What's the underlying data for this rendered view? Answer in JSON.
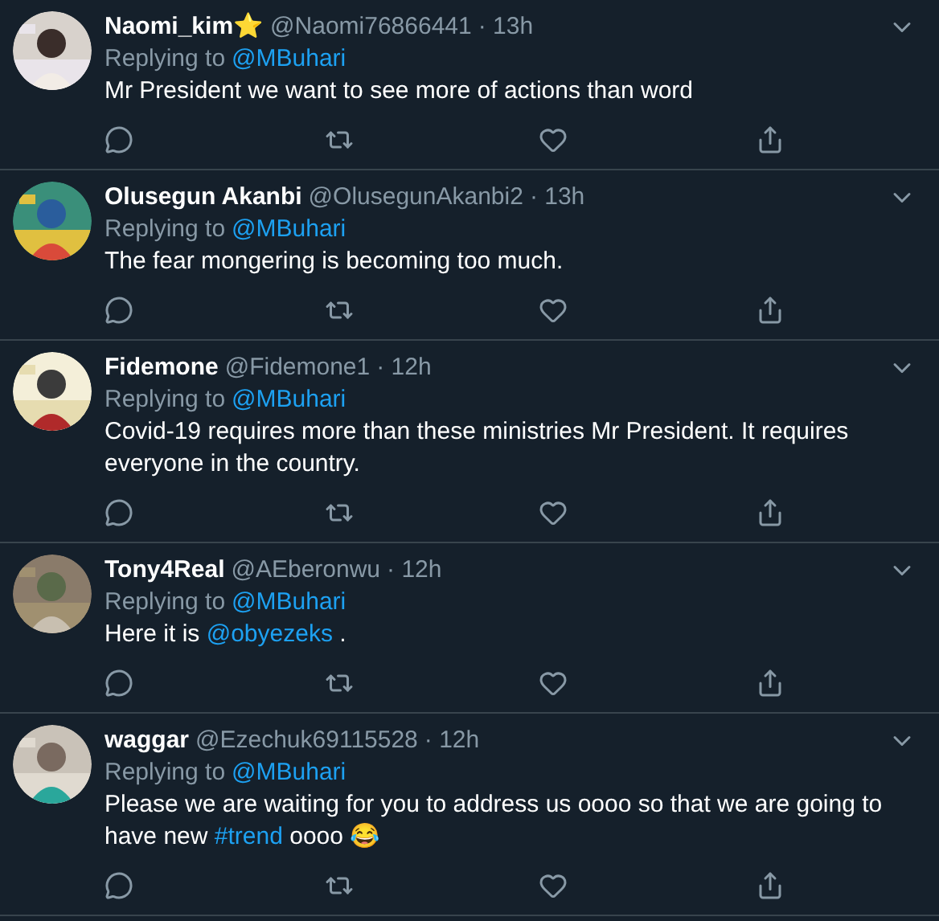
{
  "tweets": [
    {
      "name": "Naomi_kim⭐",
      "handle": "@Naomi76866441",
      "time": "· 13h",
      "replying_to": "Replying to",
      "reply_handle": "@MBuhari",
      "body": [
        {
          "kind": "text",
          "text": "Mr President we want to see more of actions than word"
        }
      ]
    },
    {
      "name": "Olusegun Akanbi",
      "handle": "@OlusegunAkanbi2",
      "time": "· 13h",
      "replying_to": "Replying to",
      "reply_handle": "@MBuhari",
      "body": [
        {
          "kind": "text",
          "text": "The fear mongering is becoming too much."
        }
      ]
    },
    {
      "name": "Fidemone",
      "handle": "@Fidemone1",
      "time": "· 12h",
      "replying_to": "Replying to",
      "reply_handle": "@MBuhari",
      "body": [
        {
          "kind": "text",
          "text": "Covid-19 requires more than these ministries Mr President. It requires everyone in the country."
        }
      ]
    },
    {
      "name": "Tony4Real",
      "handle": "@AEberonwu",
      "time": "· 12h",
      "replying_to": "Replying to",
      "reply_handle": "@MBuhari",
      "body": [
        {
          "kind": "text",
          "text": "Here it is "
        },
        {
          "kind": "link",
          "text": "@obyezeks"
        },
        {
          "kind": "text",
          "text": " ."
        }
      ]
    },
    {
      "name": "waggar",
      "handle": "@Ezechuk69115528",
      "time": "· 12h",
      "replying_to": "Replying to",
      "reply_handle": "@MBuhari",
      "body": [
        {
          "kind": "text",
          "text": "Please we are waiting for you to address us oooo so that we are going to have new "
        },
        {
          "kind": "link",
          "text": "#trend"
        },
        {
          "kind": "text",
          "text": " oooo 😂"
        }
      ]
    }
  ]
}
